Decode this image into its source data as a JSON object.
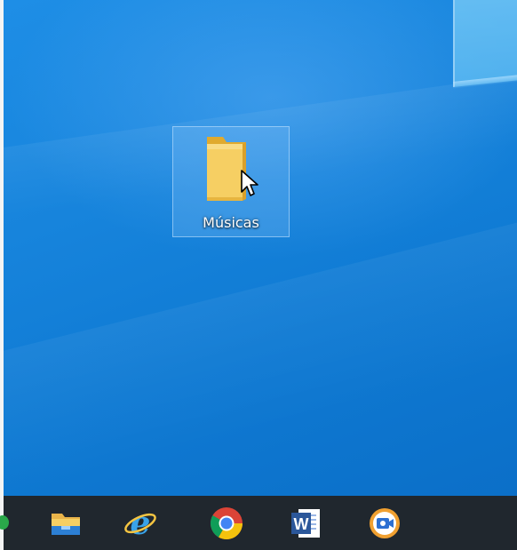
{
  "desktop": {
    "icons": [
      {
        "label": "Músicas",
        "icon": "folder-icon",
        "selected": true
      }
    ]
  },
  "taskbar": {
    "items": [
      {
        "name": "partial-app-icon"
      },
      {
        "name": "file-explorer-icon"
      },
      {
        "name": "internet-explorer-icon"
      },
      {
        "name": "chrome-icon"
      },
      {
        "name": "word-icon"
      },
      {
        "name": "camera-app-icon"
      }
    ]
  },
  "colors": {
    "desktop_blue": "#1784dc",
    "taskbar": "#20272e",
    "folder_yellow": "#f4c95d"
  }
}
